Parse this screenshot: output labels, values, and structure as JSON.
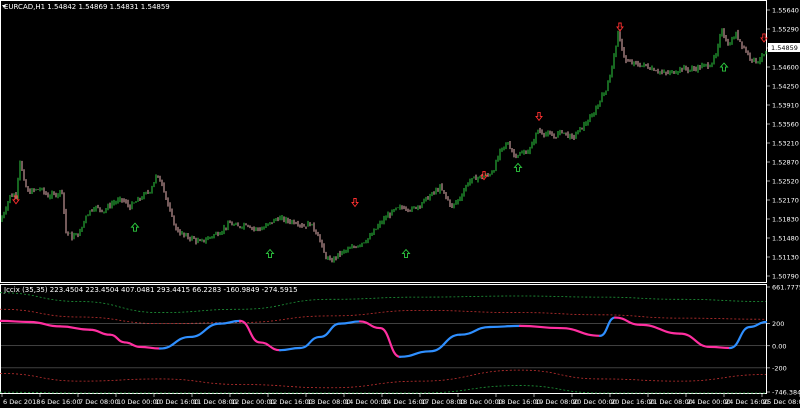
{
  "main_panel": {
    "header": "EURCAD,H1  1.54842 1.54869 1.54831 1.54859",
    "price_labels": [
      "1.55640",
      "1.55290",
      "1.54950",
      "1.54600",
      "1.54250",
      "1.53910",
      "1.53560",
      "1.53210",
      "1.52870",
      "1.52520",
      "1.52170",
      "1.51830",
      "1.51480",
      "1.51130",
      "1.50790"
    ],
    "current_price": "1.54859",
    "colors": {
      "bull": "#2ecc40",
      "bear": "#e8b4b4",
      "up_arrow": "#2ecc40",
      "down_arrow": "#ff3030",
      "frame": "#ffffff"
    }
  },
  "indicator_panel": {
    "header": "Jccix (35,35) 223.4504 223.4504 407.0481 293.4415 66.2283 -160.9849 -274.5915",
    "labels": [
      "661.7775",
      "200",
      "0.00",
      "-200",
      "-746.3849"
    ],
    "colors": {
      "rising": "#2f8fff",
      "falling": "#ff2fa0",
      "outer_band": "#1f9a3a",
      "inner_band": "#c03030",
      "zero_line": "#808080"
    }
  },
  "time_axis": [
    "6 Dec 2018",
    "6 Dec 16:00",
    "7 Dec 08:00",
    "10 Dec 00:00",
    "10 Dec 16:00",
    "11 Dec 08:00",
    "12 Dec 00:00",
    "12 Dec 16:00",
    "13 Dec 08:00",
    "14 Dec 00:00",
    "14 Dec 16:00",
    "17 Dec 08:00",
    "18 Dec 00:00",
    "18 Dec 16:00",
    "19 Dec 08:00",
    "20 Dec 00:00",
    "20 Dec 16:00",
    "21 Dec 08:00",
    "24 Dec 00:00",
    "24 Dec 16:00",
    "25 Dec 08:00",
    "26 Dec 00:00",
    "26 Dec 16:00"
  ],
  "chart_data": {
    "type": "candlestick",
    "symbol": "EURCAD,H1",
    "ylim": [
      1.5079,
      1.5564
    ],
    "keypoints": [
      [
        0,
        1.5178
      ],
      [
        6,
        1.5205
      ],
      [
        10,
        1.5225
      ],
      [
        16,
        1.5228
      ],
      [
        20,
        1.529
      ],
      [
        24,
        1.525
      ],
      [
        28,
        1.5232
      ],
      [
        40,
        1.5238
      ],
      [
        48,
        1.5225
      ],
      [
        56,
        1.5228
      ],
      [
        62,
        1.5235
      ],
      [
        66,
        1.516
      ],
      [
        72,
        1.515
      ],
      [
        80,
        1.5158
      ],
      [
        86,
        1.519
      ],
      [
        94,
        1.5205
      ],
      [
        104,
        1.5198
      ],
      [
        112,
        1.5212
      ],
      [
        122,
        1.5218
      ],
      [
        130,
        1.5205
      ],
      [
        140,
        1.522
      ],
      [
        150,
        1.5235
      ],
      [
        156,
        1.526
      ],
      [
        162,
        1.525
      ],
      [
        170,
        1.5195
      ],
      [
        176,
        1.5165
      ],
      [
        184,
        1.5152
      ],
      [
        192,
        1.5148
      ],
      [
        200,
        1.514
      ],
      [
        210,
        1.515
      ],
      [
        220,
        1.516
      ],
      [
        230,
        1.5175
      ],
      [
        238,
        1.5168
      ],
      [
        246,
        1.5175
      ],
      [
        254,
        1.5165
      ],
      [
        262,
        1.5165
      ],
      [
        270,
        1.5175
      ],
      [
        278,
        1.5185
      ],
      [
        286,
        1.518
      ],
      [
        296,
        1.5178
      ],
      [
        304,
        1.517
      ],
      [
        310,
        1.5175
      ],
      [
        318,
        1.5155
      ],
      [
        324,
        1.512
      ],
      [
        330,
        1.5105
      ],
      [
        340,
        1.512
      ],
      [
        350,
        1.5128
      ],
      [
        360,
        1.5138
      ],
      [
        370,
        1.515
      ],
      [
        378,
        1.517
      ],
      [
        388,
        1.519
      ],
      [
        396,
        1.52
      ],
      [
        404,
        1.5205
      ],
      [
        412,
        1.52
      ],
      [
        420,
        1.521
      ],
      [
        430,
        1.5225
      ],
      [
        440,
        1.524
      ],
      [
        452,
        1.5205
      ],
      [
        460,
        1.5222
      ],
      [
        468,
        1.525
      ],
      [
        476,
        1.5258
      ],
      [
        488,
        1.5262
      ],
      [
        494,
        1.5275
      ],
      [
        500,
        1.5305
      ],
      [
        508,
        1.5322
      ],
      [
        514,
        1.53
      ],
      [
        522,
        1.5302
      ],
      [
        530,
        1.531
      ],
      [
        538,
        1.5345
      ],
      [
        546,
        1.5338
      ],
      [
        554,
        1.5333
      ],
      [
        562,
        1.5343
      ],
      [
        572,
        1.533
      ],
      [
        582,
        1.535
      ],
      [
        592,
        1.537
      ],
      [
        600,
        1.54
      ],
      [
        606,
        1.542
      ],
      [
        612,
        1.546
      ],
      [
        618,
        1.552
      ],
      [
        626,
        1.547
      ],
      [
        636,
        1.5465
      ],
      [
        646,
        1.5462
      ],
      [
        656,
        1.5455
      ],
      [
        664,
        1.5448
      ],
      [
        672,
        1.545
      ],
      [
        682,
        1.5458
      ],
      [
        690,
        1.5455
      ],
      [
        700,
        1.546
      ],
      [
        710,
        1.5465
      ],
      [
        716,
        1.548
      ],
      [
        722,
        1.553
      ],
      [
        728,
        1.55
      ],
      [
        736,
        1.552
      ],
      [
        744,
        1.5495
      ],
      [
        750,
        1.5478
      ],
      [
        756,
        1.547
      ],
      [
        762,
        1.5478
      ],
      [
        766,
        1.5486
      ]
    ],
    "up_arrows": [
      [
        135,
        1.5168
      ],
      [
        270,
        1.512
      ],
      [
        406,
        1.512
      ],
      [
        518,
        1.5277
      ],
      [
        724,
        1.546
      ]
    ],
    "down_arrows": [
      [
        16,
        1.5218
      ],
      [
        355,
        1.5213
      ],
      [
        484,
        1.5262
      ],
      [
        539,
        1.537
      ],
      [
        620,
        1.5533
      ],
      [
        764,
        1.5513
      ]
    ]
  },
  "indicator_data": {
    "type": "line",
    "ylim": [
      -400,
      450
    ],
    "jccix": [
      [
        0,
        225
      ],
      [
        30,
        215
      ],
      [
        60,
        175
      ],
      [
        90,
        145
      ],
      [
        110,
        100
      ],
      [
        125,
        30
      ],
      [
        140,
        -10
      ],
      [
        160,
        -25
      ],
      [
        190,
        80
      ],
      [
        220,
        200
      ],
      [
        240,
        225
      ],
      [
        260,
        30
      ],
      [
        280,
        -40
      ],
      [
        300,
        -20
      ],
      [
        320,
        80
      ],
      [
        340,
        200
      ],
      [
        360,
        220
      ],
      [
        380,
        160
      ],
      [
        400,
        -100
      ],
      [
        430,
        -50
      ],
      [
        460,
        100
      ],
      [
        490,
        170
      ],
      [
        520,
        180
      ],
      [
        560,
        160
      ],
      [
        600,
        90
      ],
      [
        615,
        255
      ],
      [
        640,
        190
      ],
      [
        680,
        110
      ],
      [
        710,
        -10
      ],
      [
        730,
        -20
      ],
      [
        750,
        170
      ],
      [
        766,
        215
      ]
    ],
    "band_outer": [
      {
        "side": "upper",
        "points": [
          [
            0,
            480
          ],
          [
            80,
            400
          ],
          [
            160,
            300
          ],
          [
            240,
            330
          ],
          [
            330,
            420
          ],
          [
            420,
            440
          ],
          [
            520,
            450
          ],
          [
            600,
            440
          ],
          [
            680,
            420
          ],
          [
            766,
            400
          ]
        ]
      },
      {
        "side": "lower",
        "points": [
          [
            0,
            -420
          ],
          [
            80,
            -520
          ],
          [
            160,
            -480
          ],
          [
            240,
            -560
          ],
          [
            330,
            -600
          ],
          [
            420,
            -520
          ],
          [
            520,
            -360
          ],
          [
            600,
            -500
          ],
          [
            680,
            -500
          ],
          [
            766,
            -440
          ]
        ]
      }
    ],
    "band_inner": [
      {
        "side": "upper",
        "points": [
          [
            0,
            330
          ],
          [
            80,
            260
          ],
          [
            160,
            200
          ],
          [
            240,
            210
          ],
          [
            330,
            270
          ],
          [
            420,
            320
          ],
          [
            520,
            300
          ],
          [
            600,
            280
          ],
          [
            680,
            250
          ],
          [
            766,
            240
          ]
        ]
      },
      {
        "side": "lower",
        "points": [
          [
            0,
            -250
          ],
          [
            80,
            -320
          ],
          [
            160,
            -300
          ],
          [
            240,
            -350
          ],
          [
            330,
            -380
          ],
          [
            420,
            -320
          ],
          [
            520,
            -220
          ],
          [
            600,
            -300
          ],
          [
            680,
            -320
          ],
          [
            766,
            -260
          ]
        ]
      }
    ]
  }
}
